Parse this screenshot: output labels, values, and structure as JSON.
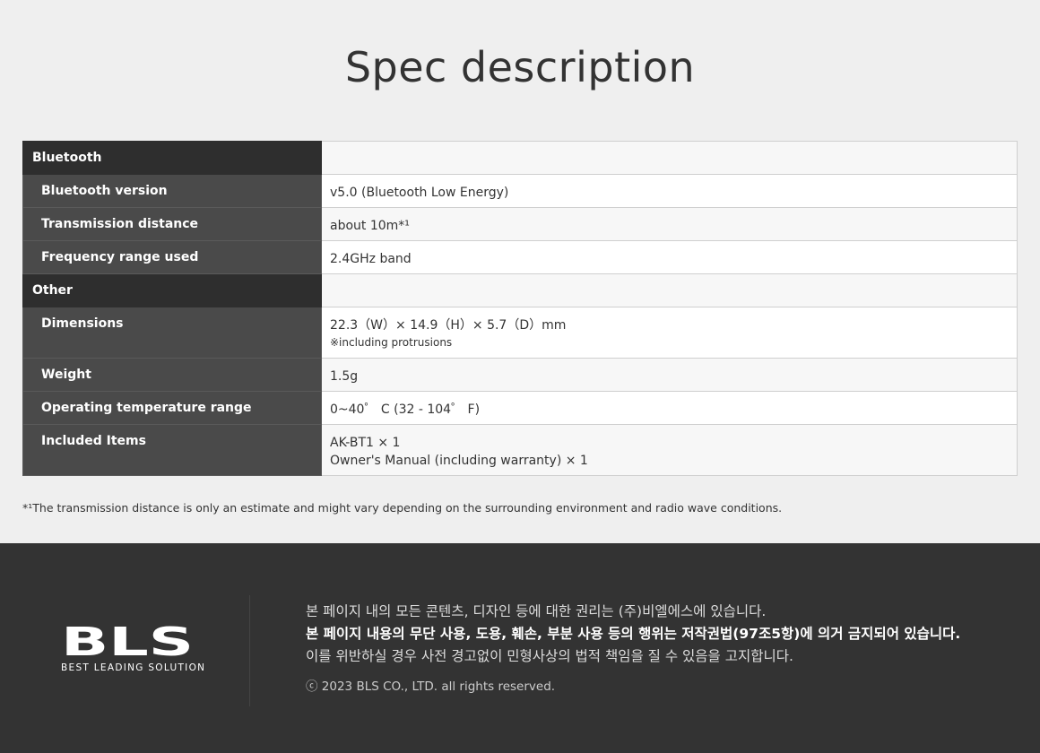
{
  "page": {
    "title": "Spec description"
  },
  "spec_table": {
    "sections": [
      {
        "label": "Bluetooth",
        "rows": [
          {
            "label": "Bluetooth version",
            "value": "v5.0 (Bluetooth Low Energy)"
          },
          {
            "label": "Transmission distance",
            "value": "about 10m*¹"
          },
          {
            "label": "Frequency range used",
            "value": "2.4GHz band"
          }
        ]
      },
      {
        "label": "Other",
        "rows": [
          {
            "label": "Dimensions",
            "value": "22.3（W）× 14.9（H）× 5.7（D）mm",
            "note": "※including protrusions"
          },
          {
            "label": "Weight",
            "value": "1.5g"
          },
          {
            "label": "Operating temperature range",
            "value": "0~40゜ C (32 - 104゜ F)"
          },
          {
            "label": "Included Items",
            "value": "AK-BT1 × 1",
            "value2": "Owner's Manual (including warranty) × 1"
          }
        ]
      }
    ]
  },
  "footnote": "*¹The transmission distance is only an estimate and might vary depending on the surrounding environment and radio wave conditions.",
  "footer": {
    "logo_text": "BLS",
    "logo_subtitle": "BEST LEADING SOLUTION",
    "line1": "본 페이지 내의 모든 콘텐츠, 디자인 등에 대한 권리는 (주)비엘에스에 있습니다.",
    "line2": "본 페이지 내용의 무단 사용, 도용, 훼손, 부분 사용 등의 행위는 저작권법(97조5항)에 의거 금지되어 있습니다.",
    "line3": "이를 위반하실 경우 사전 경고없이 민형사상의 법적 책임을 질 수 있음을 고지합니다.",
    "copyright": "ⓒ 2023 BLS CO., LTD. all rights reserved."
  },
  "colors": {
    "background": "#efefef",
    "section_header": "#2e2e2e",
    "row_label": "#4a4a4a",
    "footer": "#333333"
  }
}
